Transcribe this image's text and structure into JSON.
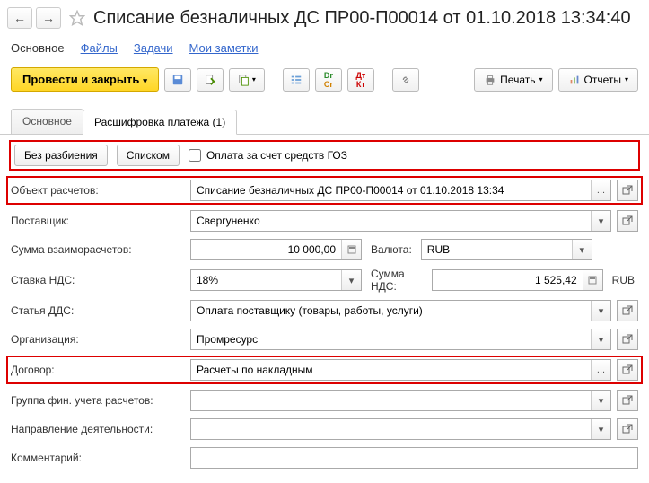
{
  "header": {
    "title": "Списание безналичных ДС ПР00-П00014 от 01.10.2018 13:34:40"
  },
  "nav_tabs": {
    "main": "Основное",
    "files": "Файлы",
    "tasks": "Задачи",
    "notes": "Мои заметки"
  },
  "toolbar": {
    "post_close": "Провести и закрыть",
    "print": "Печать",
    "reports": "Отчеты",
    "drcr": "DrCr",
    "dtdk": "Дт Кт"
  },
  "subtabs": {
    "main": "Основное",
    "breakdown": "Расшифровка платежа (1)"
  },
  "toggle": {
    "no_split": "Без разбиения",
    "list": "Списком",
    "goz": "Оплата за счет средств ГОЗ"
  },
  "fields": {
    "calc_object": {
      "label": "Объект расчетов:",
      "value": "Списание безналичных ДС ПР00-П00014 от 01.10.2018 13:34"
    },
    "supplier": {
      "label": "Поставщик:",
      "value": "Свергуненко"
    },
    "sum": {
      "label": "Сумма взаиморасчетов:",
      "value": "10 000,00"
    },
    "currency_label": "Валюта:",
    "currency_value": "RUB",
    "vat_rate": {
      "label": "Ставка НДС:",
      "value": "18%"
    },
    "vat_sum_label": "Сумма НДС:",
    "vat_sum_value": "1 525,42",
    "currency_suffix": "RUB",
    "dds": {
      "label": "Статья ДДС:",
      "value": "Оплата поставщику (товары, работы, услуги)"
    },
    "org": {
      "label": "Организация:",
      "value": "Промресурс"
    },
    "contract": {
      "label": "Договор:",
      "value": "Расчеты по накладным"
    },
    "fingroup": {
      "label": "Группа фин. учета расчетов:",
      "value": ""
    },
    "activity": {
      "label": "Направление деятельности:",
      "value": ""
    },
    "comment": {
      "label": "Комментарий:",
      "value": ""
    }
  },
  "icons": {
    "ellipsis": "...",
    "open": "↗",
    "dropdown": "▾",
    "calc": "▫"
  }
}
